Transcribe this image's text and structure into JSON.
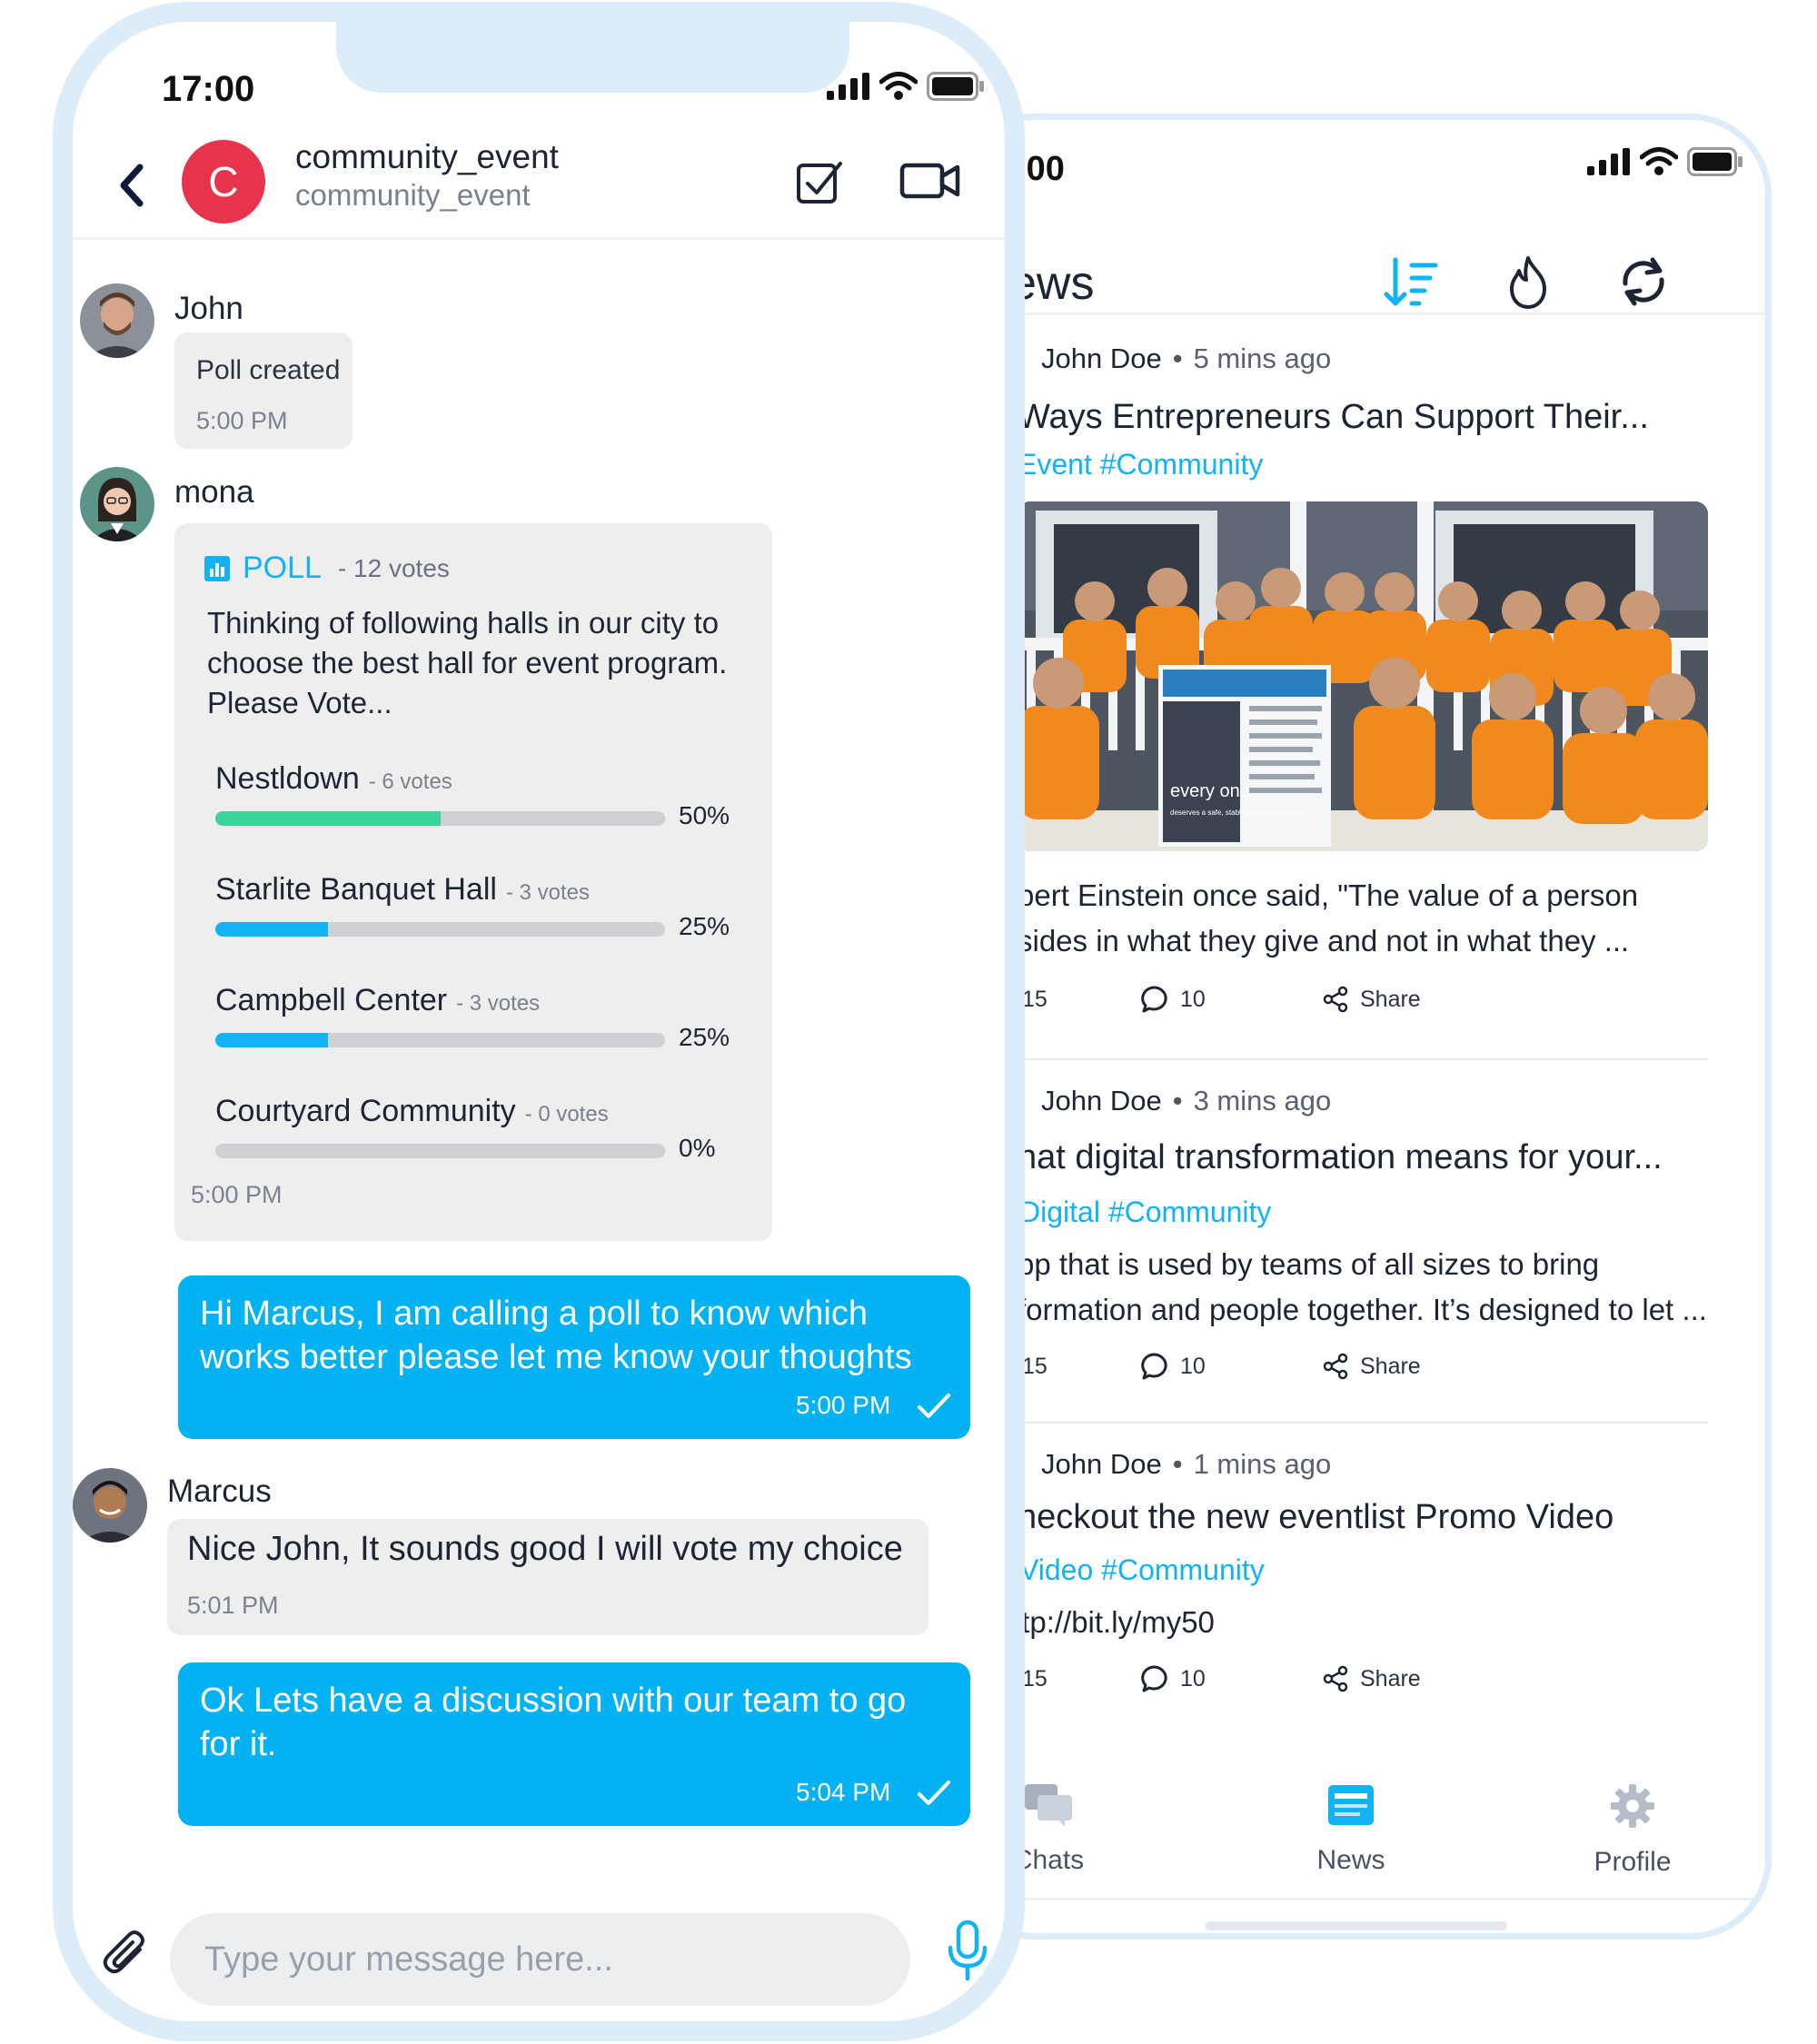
{
  "news_phone": {
    "status_time": ":00",
    "header_title": "ews",
    "posts": [
      {
        "author": "John Doe",
        "time_ago": "5 mins ago",
        "title": "Ways Entrepreneurs Can Support Their...",
        "tags": "Event #Community",
        "image_text": "every one",
        "image_subtext": "deserves a safe, stable place to call home.",
        "body_line1": "bert Einstein once said, \"The value of a person",
        "body_line2": "sides in what they give and not in what they ...",
        "likes": "15",
        "comments": "10",
        "share_label": "Share"
      },
      {
        "author": "John Doe",
        "time_ago": "3 mins ago",
        "title": "hat digital transformation means for your...",
        "tags": "Digital #Community",
        "body_line1": "pp that  is used by teams of all sizes to bring",
        "body_line2": "formation and people together. It’s designed to let ...",
        "likes": "15",
        "comments": "10",
        "share_label": "Share"
      },
      {
        "author": "John Doe",
        "time_ago": "1 mins ago",
        "title": "heckout the new eventlist  Promo Video",
        "tags": "Video #Community",
        "body_line1": "ttp://bit.ly/my50",
        "likes": "15",
        "comments": "10",
        "share_label": "Share"
      }
    ],
    "tabs": [
      {
        "label": "Chats",
        "icon": "chats-icon"
      },
      {
        "label": "News",
        "icon": "news-icon"
      },
      {
        "label": "Profile",
        "icon": "gear-icon"
      }
    ]
  },
  "chat_phone": {
    "status_time": "17:00",
    "group_initial": "C",
    "group_title": "community_event",
    "group_subtitle": "community_event",
    "messages": {
      "john": {
        "sender": "John",
        "text": "Poll created",
        "time": "5:00 PM"
      },
      "mona": {
        "sender": "mona",
        "time": "5:00 PM"
      },
      "out1": {
        "line1": "Hi Marcus, I am calling a poll to know which",
        "line2": "works better please let me know your thoughts",
        "time": "5:00 PM"
      },
      "marcus": {
        "sender": "Marcus",
        "text": "Nice John, It sounds good I will vote my choice",
        "time": "5:01 PM"
      },
      "out2": {
        "line1": "Ok Lets have a discussion with our team to go",
        "line2": "for it.",
        "time": "5:04 PM"
      }
    },
    "poll": {
      "label": "POLL",
      "votes": "- 12 votes",
      "question": "Thinking of following halls in our city to choose the best hall for event program. Please Vote...",
      "options": [
        {
          "name": "Nestldown",
          "votes": "- 6 votes",
          "percent": "50%",
          "fraction": 0.5,
          "color": "#3ad49a"
        },
        {
          "name": "Starlite Banquet Hall",
          "votes": "- 3 votes",
          "percent": "25%",
          "fraction": 0.25,
          "color": "#11b3f5"
        },
        {
          "name": "Campbell Center",
          "votes": "- 3 votes",
          "percent": "25%",
          "fraction": 0.25,
          "color": "#11b3f5"
        },
        {
          "name": "Courtyard Community",
          "votes": "- 0 votes",
          "percent": "0%",
          "fraction": 0,
          "color": "#11b3f5"
        }
      ]
    },
    "input_placeholder": "Type your message here..."
  },
  "colors": {
    "accent": "#02b2f2",
    "poll_green": "#3ad49a",
    "avatar_red": "#e8344b",
    "bezel": "#dcecf8"
  }
}
